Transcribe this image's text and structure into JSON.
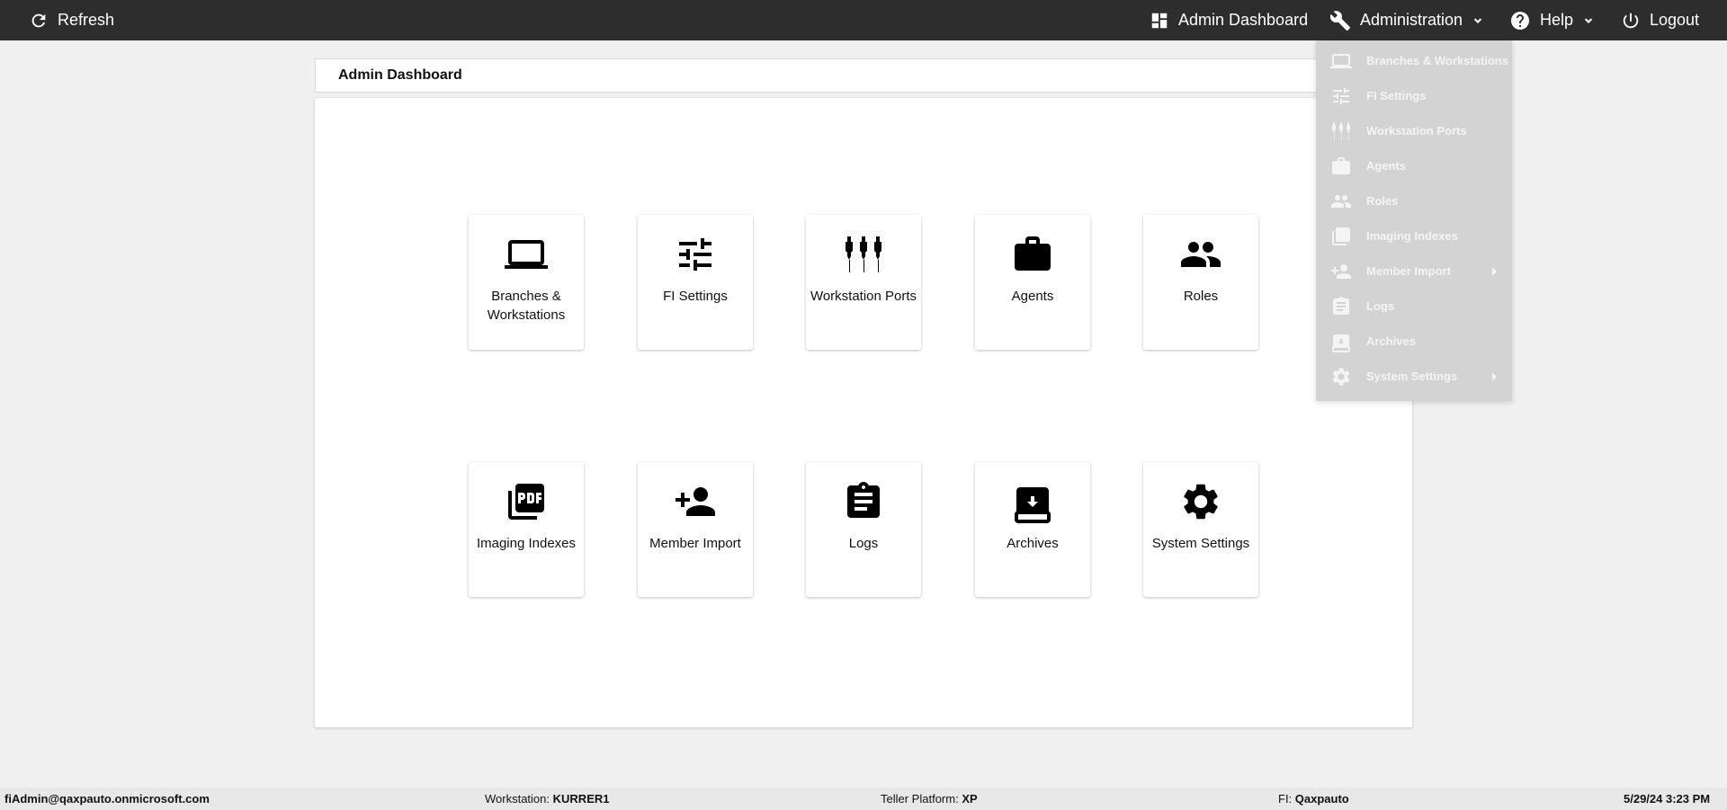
{
  "topbar": {
    "refresh_label": "Refresh",
    "admin_dashboard_label": "Admin Dashboard",
    "administration_label": "Administration",
    "help_label": "Help",
    "logout_label": "Logout"
  },
  "page": {
    "title": "Admin Dashboard"
  },
  "tiles": [
    {
      "label": "Branches & Workstations",
      "icon": "laptop-icon"
    },
    {
      "label": "FI Settings",
      "icon": "tune-icon"
    },
    {
      "label": "Workstation Ports",
      "icon": "cable-icon"
    },
    {
      "label": "Agents",
      "icon": "briefcase-icon"
    },
    {
      "label": "Roles",
      "icon": "people-icon"
    },
    {
      "label": "Imaging Indexes",
      "icon": "pdf-icon"
    },
    {
      "label": "Member Import",
      "icon": "person-add-icon"
    },
    {
      "label": "Logs",
      "icon": "clipboard-icon"
    },
    {
      "label": "Archives",
      "icon": "archive-icon"
    },
    {
      "label": "System Settings",
      "icon": "gear-icon"
    }
  ],
  "administration_menu": [
    {
      "label": "Branches & Workstations",
      "icon": "laptop-icon",
      "submenu": false
    },
    {
      "label": "FI Settings",
      "icon": "tune-icon",
      "submenu": false
    },
    {
      "label": "Workstation Ports",
      "icon": "cable-icon",
      "submenu": false
    },
    {
      "label": "Agents",
      "icon": "briefcase-icon",
      "submenu": false
    },
    {
      "label": "Roles",
      "icon": "people-icon",
      "submenu": false
    },
    {
      "label": "Imaging Indexes",
      "icon": "pdf-icon",
      "submenu": false
    },
    {
      "label": "Member Import",
      "icon": "person-add-icon",
      "submenu": true
    },
    {
      "label": "Logs",
      "icon": "clipboard-icon",
      "submenu": false
    },
    {
      "label": "Archives",
      "icon": "archive-icon",
      "submenu": false
    },
    {
      "label": "System Settings",
      "icon": "gear-icon",
      "submenu": true
    }
  ],
  "footer": {
    "user": "fiAdmin@qaxpauto.onmicrosoft.com",
    "workstation_label": "Workstation:",
    "workstation_value": "KURRER1",
    "teller_platform_label": "Teller Platform:",
    "teller_platform_value": "XP",
    "fi_label": "FI:",
    "fi_value": "Qaxpauto",
    "datetime": "5/29/24 3:23 PM"
  },
  "colors": {
    "topbar_bg": "#2d2d2d",
    "page_bg": "#f0f0f0",
    "menu_bg": "#d3d3d3",
    "footer_bg": "#e8e8e8"
  }
}
